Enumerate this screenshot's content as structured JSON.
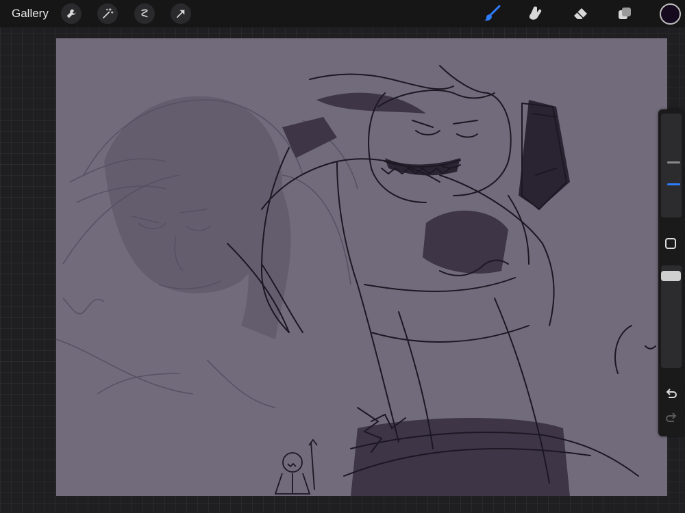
{
  "toolbar": {
    "gallery_label": "Gallery",
    "left_tools": [
      "wrench-icon",
      "magic-wand-icon",
      "selection-icon",
      "transform-arrow-icon"
    ],
    "right_tools": [
      "brush-icon",
      "smudge-icon",
      "eraser-icon",
      "layers-icon"
    ],
    "active_tool": "brush-icon",
    "current_color": "#150a1e",
    "accent_color": "#2f7dff"
  },
  "canvas": {
    "background_color": "#716b7b",
    "stroke_color": "#1d1724"
  },
  "sidebar": {
    "brush_size_slider": "top",
    "opacity_slider": "bottom",
    "undo_icon": "undo-icon",
    "redo_icon": "redo-icon"
  }
}
